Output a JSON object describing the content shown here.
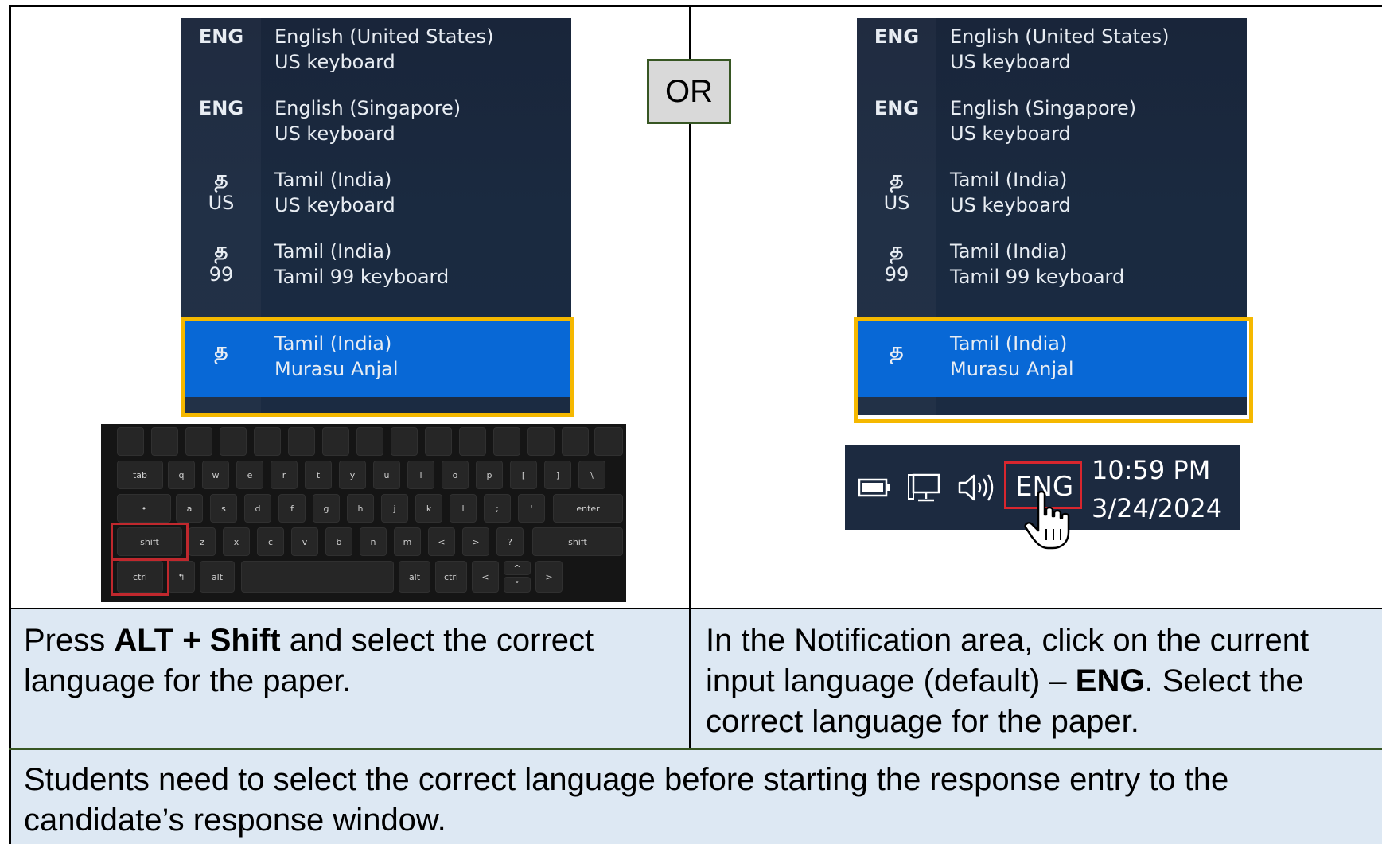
{
  "or_label": "OR",
  "language_menu": {
    "items": [
      {
        "code": "ENG",
        "glyph": "",
        "sub": "",
        "line1": "English (United States)",
        "line2": "US keyboard"
      },
      {
        "code": "ENG",
        "glyph": "",
        "sub": "",
        "line1": "English (Singapore)",
        "line2": "US keyboard"
      },
      {
        "code": "",
        "glyph": "த",
        "sub": "US",
        "line1": "Tamil (India)",
        "line2": "US keyboard"
      },
      {
        "code": "",
        "glyph": "த",
        "sub": "99",
        "line1": "Tamil (India)",
        "line2": "Tamil 99 keyboard"
      },
      {
        "code": "",
        "glyph": "த",
        "sub": "",
        "line1": "Tamil (India)",
        "line2": "Murasu Anjal",
        "selected": true
      }
    ]
  },
  "keyboard": {
    "highlighted_keys": [
      "shift",
      "ctrl"
    ],
    "keys_row2": [
      "tab",
      "q",
      "w",
      "e",
      "r",
      "t",
      "y",
      "u",
      "i",
      "o",
      "p",
      "[",
      "]",
      "\\"
    ],
    "keys_row3": [
      "•",
      "a",
      "s",
      "d",
      "f",
      "g",
      "h",
      "j",
      "k",
      "l",
      ";",
      "'",
      "enter"
    ],
    "keys_row4": [
      "shift",
      "z",
      "x",
      "c",
      "v",
      "b",
      "n",
      "m",
      "<",
      ">",
      "?",
      "shift"
    ],
    "keys_row5": [
      "ctrl",
      "↰",
      "alt",
      "alt",
      "ctrl",
      "<",
      "^",
      "˅",
      ">"
    ]
  },
  "taskbar": {
    "icons": [
      "battery-icon",
      "network-icon",
      "volume-icon"
    ],
    "language": "ENG",
    "time": "10:59 PM",
    "date": "3/24/2024"
  },
  "captions": {
    "left": {
      "pre": "Press ",
      "bold": "ALT + Shift",
      "post": " and select the correct language for the paper."
    },
    "right": {
      "pre": "In the Notification area, click on the current input language (default) – ",
      "bold": "ENG",
      "post": ". Select the correct language for the paper."
    },
    "bottom": "Students need to select the correct language before starting the response entry to the candidate’s response window."
  },
  "colors": {
    "menu_bg": "#19253a",
    "selected_bg": "#0868d6",
    "highlight_yellow": "#f5b800",
    "highlight_red": "#d8262e",
    "caption_bg": "#dde8f3",
    "or_border": "#375623"
  }
}
